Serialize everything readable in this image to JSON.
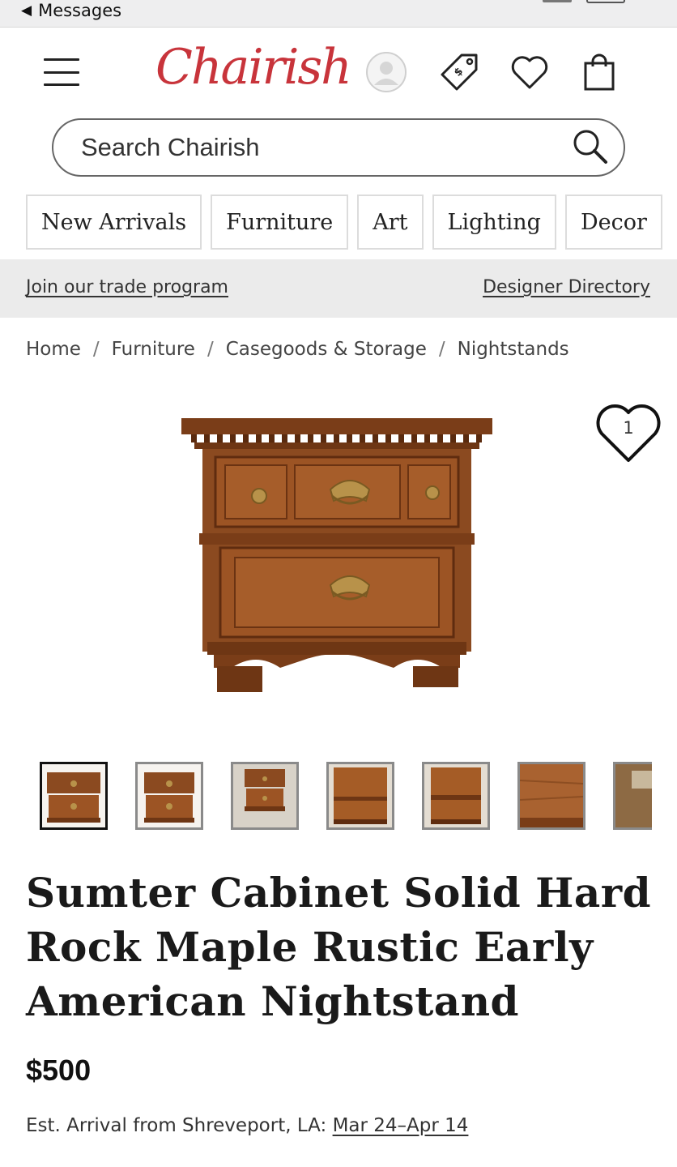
{
  "status_bar": {
    "back_label": "Messages"
  },
  "header": {
    "logo_text": "Chairish",
    "menu_icon": "hamburger-menu-icon",
    "icons": [
      "user-avatar-icon",
      "price-tag-icon",
      "heart-icon",
      "shopping-bag-icon"
    ]
  },
  "search": {
    "placeholder": "Search Chairish",
    "icon": "search-icon"
  },
  "nav": {
    "items": [
      {
        "label": "New Arrivals"
      },
      {
        "label": "Furniture"
      },
      {
        "label": "Art"
      },
      {
        "label": "Lighting"
      },
      {
        "label": "Decor"
      }
    ]
  },
  "trade_bar": {
    "trade_link": "Join our trade program",
    "designer_link": "Designer Directory"
  },
  "breadcrumb": {
    "separator": "/",
    "items": [
      "Home",
      "Furniture",
      "Casegoods & Storage",
      "Nightstands"
    ]
  },
  "product": {
    "favorite_count": "1",
    "title": "Sumter Cabinet Solid Hard Rock Maple Rustic Early American Nightstand",
    "price": "$500",
    "arrival_prefix": "Est. Arrival from Shreveport, LA: ",
    "arrival_dates": "Mar 24–Apr 14"
  },
  "colors": {
    "brand": "#c8343b",
    "wood": "#8b4a20",
    "brass": "#b8924a"
  }
}
